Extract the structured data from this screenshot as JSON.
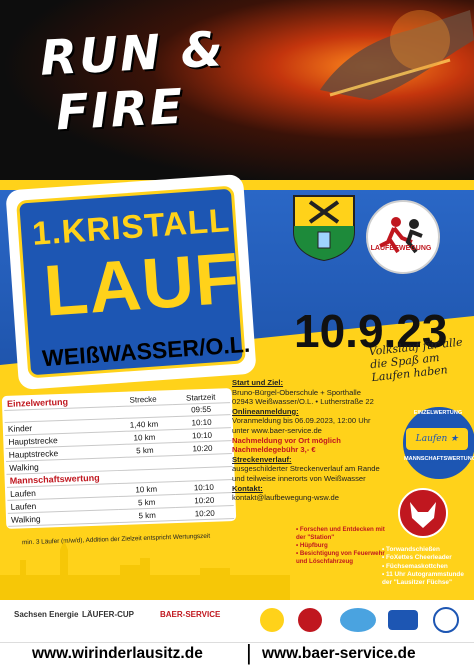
{
  "poster": {
    "headline_run": "RUN &",
    "headline_fire": "FIRE",
    "title_line1": "1.KRISTALL",
    "title_line2": "LAUF",
    "title_line3": "WEIßWASSER/O.L.",
    "date": "10.9.23",
    "slogan": "Volkslauf für alle die Spaß am Laufen haben",
    "logo_text": "LAUFBEWEGUNG"
  },
  "table": {
    "headers": [
      "",
      "Strecke",
      "Startzeit"
    ],
    "sections": [
      {
        "title": "Einzelwertung",
        "rows": [
          {
            "name": "",
            "distance": "",
            "time": "09:55"
          },
          {
            "name": "Kinder",
            "distance": "1,40 km",
            "time": "10:10"
          },
          {
            "name": "Hauptstrecke",
            "distance": "10 km",
            "time": "10:10"
          },
          {
            "name": "Hauptstrecke",
            "distance": "5 km",
            "time": "10:20"
          },
          {
            "name": "Walking",
            "distance": "",
            "time": ""
          }
        ]
      },
      {
        "title": "Mannschaftswertung",
        "rows": [
          {
            "name": "Laufen",
            "distance": "10 km",
            "time": "10:10"
          },
          {
            "name": "Laufen",
            "distance": "5 km",
            "time": "10:20"
          },
          {
            "name": "Walking",
            "distance": "5 km",
            "time": "10:20"
          }
        ]
      }
    ],
    "note": "min. 3 Läufer (m/w/d), Addition der Zielzeit entspricht Wertungszeit"
  },
  "info": {
    "start_head": "Start und Ziel:",
    "start_text": "Bruno-Bürgel-Oberschule + Sporthalle 02943 Weißwasser/O.L. • Lutherstraße 22",
    "anmeldung_head": "Onlineanmeldung:",
    "anmeldung_text": "Voranmeldung bis 06.09.2023, 12:00 Uhr unter www.baer-service.de",
    "nach_text": "Nachmeldung vor Ort möglich",
    "gebuehr_text": "Nachmeldegebühr 3,- €",
    "strecke_head": "Streckenverlauf:",
    "strecke_text": "ausgeschilderter Streckenverlauf am Rande und teilweise innerorts von Weißwasser",
    "kontakt_head": "Kontakt:",
    "kontakt_text": "kontakt@laufbewegung-wsw.de"
  },
  "badge": {
    "top": "EINZELWERTUNG",
    "middle": "Laufen ★ Walken",
    "bottom": "MANNSCHAFTSWERTUNG"
  },
  "promo": [
    "• Forschen und Entdecken mit der \"Station\"",
    "• Hüpfburg",
    "• Besichtigung von Feuerwehr und Löschfahrzeug"
  ],
  "esw": {
    "title": "ESW:",
    "items": [
      "• Torwandschießen",
      "• FoXettes Cheerleader",
      "• Füchsemaskottchen",
      "• 11 Uhr Autogrammstunde der \"Lausitzer Füchse\""
    ]
  },
  "sponsors": [
    "Sachsen Energie",
    "LÄUFER-CUP",
    "BAER-SERVICE"
  ],
  "footer": {
    "link1": "www.wirinderlausitz.de",
    "separator": "|",
    "link2": "www.baer-service.de"
  },
  "colors": {
    "blue": "#1d56b3",
    "yellow": "#ffd21a",
    "red": "#c0171f"
  }
}
